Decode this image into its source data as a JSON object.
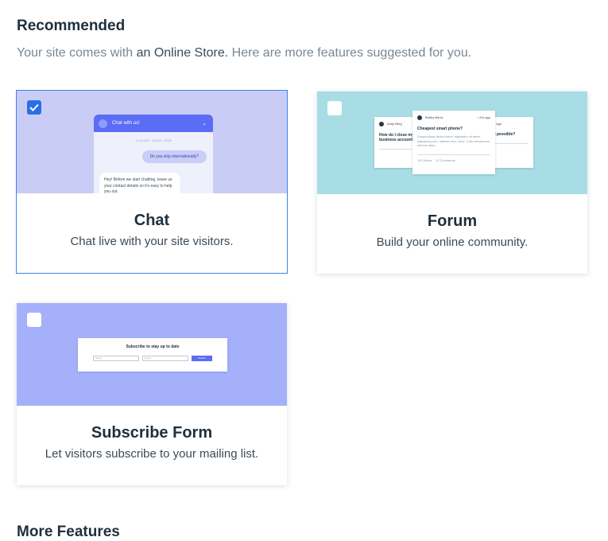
{
  "header": {
    "title": "Recommended",
    "subtitle_pre": "Your site comes with ",
    "subtitle_em": "an Online Store.",
    "subtitle_post": " Here are more features suggested for you."
  },
  "cards": [
    {
      "title": "Chat",
      "description": "Chat live with your site visitors.",
      "checked": true,
      "preview": {
        "header_label": "Chat with us!",
        "timestamp": "10:32 AM · JUN 21, 2018",
        "user_message": "Do you ship internationally?",
        "bot_message": "Hey! Before we start chatting, leave us your contact details so it's easy to help you out."
      }
    },
    {
      "title": "Forum",
      "description": "Build your online community.",
      "checked": false,
      "preview": {
        "author_left": "Andy Berg",
        "question_left": "How do I close my business account?",
        "author_center": "Bobby Berra",
        "time_center": "• 2hr ago",
        "question_center": "Cheapest smart phone?",
        "body_center": "Suspendisse lectus tortor, dignissim sit amet, adipiscing nec, ultricies sed, dolor. Cras elementum ultrices diam.",
        "views_center": "143 Views",
        "comments_center": "12 Comments",
        "time_right": "• 2hr ago",
        "question_right": "Is it possible?"
      }
    },
    {
      "title": "Subscribe Form",
      "description": "Let visitors subscribe to your mailing list.",
      "checked": false,
      "preview": {
        "form_title": "Subscribe to stay up to date",
        "name_placeholder": "Name",
        "email_placeholder": "Email",
        "submit_label": "Submit"
      }
    }
  ],
  "more_section": {
    "title": "More Features"
  },
  "colors": {
    "chat_bg": "#c9cdf5",
    "forum_bg": "#a8dde6",
    "subscribe_bg": "#a5b0fb",
    "accent": "#2b6fe8"
  }
}
